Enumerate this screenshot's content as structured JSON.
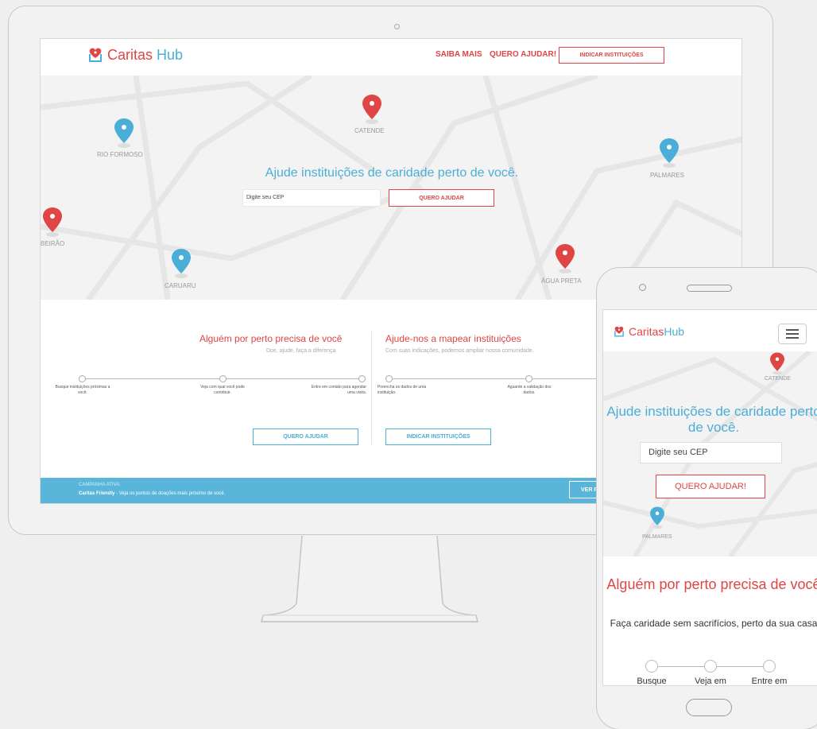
{
  "brand": {
    "name_main": "Caritas",
    "name_hub": "Hub",
    "mobile_name_main": "Caritas",
    "mobile_name_hub": "Hub"
  },
  "nav": {
    "links": [
      "SAIBA MAIS",
      "QUERO AJUDAR!"
    ],
    "button": "INDICAR INSTITUIÇÕES"
  },
  "map": {
    "labels": {
      "rio": "RIO FORMOSO",
      "catende": "CATENDE",
      "palmares": "PALMARES",
      "ribeirao": "BEIRÃO",
      "caruaru": "CARUARU",
      "agua": "ÁGUA PRETA"
    }
  },
  "hero": {
    "title": "Ajude instituições de caridade perto de você.",
    "cep_placeholder": "Digite seu CEP",
    "button": "QUERO AJUDAR"
  },
  "left_section": {
    "title": "Alguém por perto precisa de você",
    "subtitle": "Doe, ajude, faça a diferença",
    "steps": [
      "Busque instituições próximas a você.",
      "Veja com qual você pode contribuir.",
      "Entre em contato para agendar uma visita."
    ],
    "button": "QUERO AJUDAR"
  },
  "right_section": {
    "title": "Ajude-nos a mapear instituições",
    "subtitle": "Com suas indicações, podemos ampliar nossa comunidade.",
    "steps": [
      "Preencha os dados de uma instituição.",
      "Aguarde a validação dos dados."
    ],
    "button": "INDICAR INSTITUIÇÕES"
  },
  "campaign": {
    "label": "CAMPANHA ATIVA:",
    "name": "Caritas Friendly",
    "text": " - Veja os pontos de doações mais próximo de você.",
    "button": "VER P"
  },
  "mobile": {
    "map_labels": {
      "catende": "CATENDE",
      "palmares": "PALMARES"
    },
    "hero_title": "Ajude instituições de caridade perto de você.",
    "cep_placeholder": "Digite seu CEP",
    "button": "QUERO AJUDAR!",
    "section_title": "Alguém por perto precisa de você",
    "section_subtitle": "Faça caridade sem sacrifícios, perto da sua casa",
    "steps": [
      "Busque",
      "Veja em",
      "Entre em"
    ]
  },
  "colors": {
    "red": "#e04545",
    "blue": "#4aaed8",
    "campaign_bg": "#5ab5da"
  }
}
